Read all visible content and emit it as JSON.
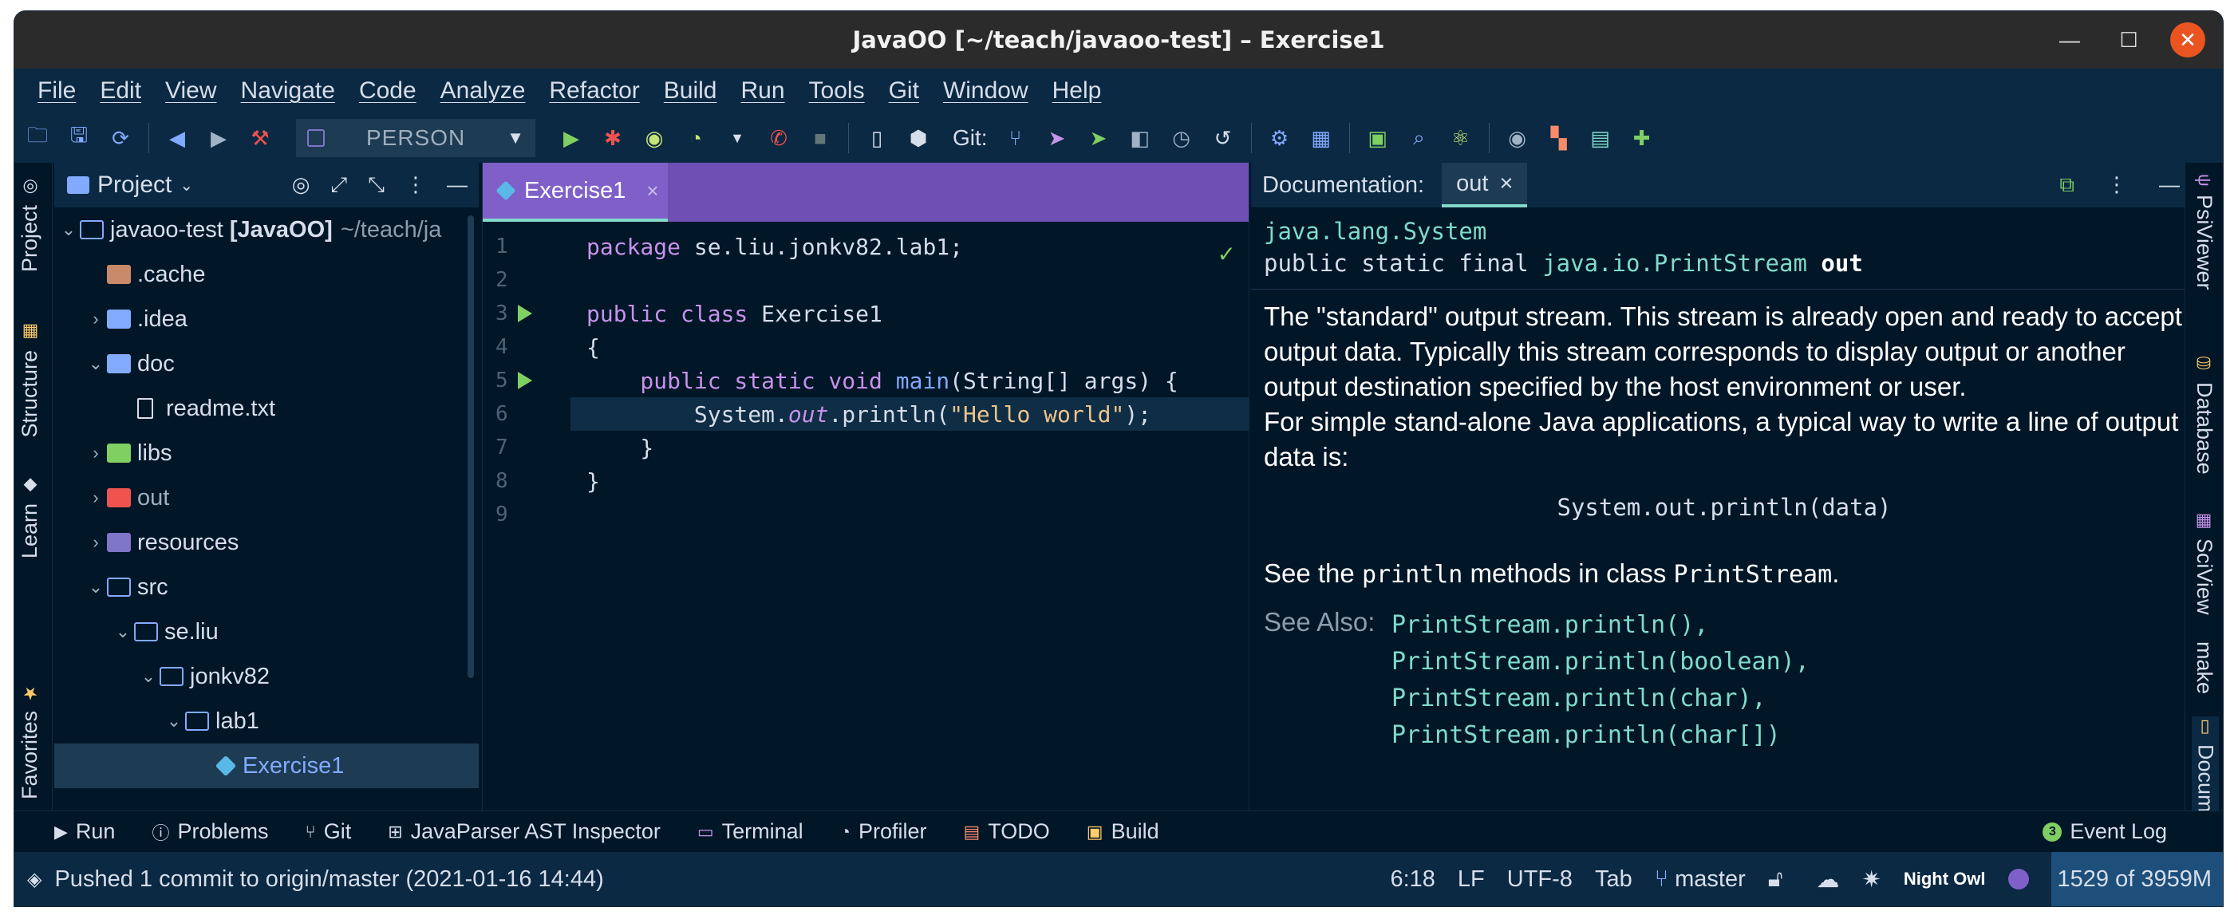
{
  "window": {
    "title": "JavaOO [~/teach/javaoo-test] – Exercise1"
  },
  "menu": [
    "File",
    "Edit",
    "View",
    "Navigate",
    "Code",
    "Analyze",
    "Refactor",
    "Build",
    "Run",
    "Tools",
    "Git",
    "Window",
    "Help"
  ],
  "toolbar": {
    "run_config": "PERSON",
    "git_label": "Git:"
  },
  "left_strip": {
    "project": "Project",
    "structure": "Structure",
    "learn": "Learn",
    "favorites": "Favorites"
  },
  "project_panel": {
    "title": "Project",
    "root": {
      "name": "javaoo-test",
      "module": "[JavaOO]",
      "path": "~/teach/ja"
    },
    "items": [
      ".cache",
      ".idea",
      "doc",
      "readme.txt",
      "libs",
      "out",
      "resources",
      "src",
      "se.liu",
      "jonkv82",
      "lab1",
      "Exercise1"
    ]
  },
  "editor": {
    "tab": "Exercise1",
    "line_numbers": [
      "1",
      "2",
      "3",
      "4",
      "5",
      "6",
      "7",
      "8",
      "9"
    ],
    "code": {
      "l1_kw": "package",
      "l1_rest": " se.liu.jonkv82.lab1;",
      "l3_kw": "public class",
      "l3_rest": " Exercise1",
      "l4": "{",
      "l5_kw": "    public static void",
      "l5_fn": " main",
      "l5_rest": "(String[] args) {",
      "l6_a": "        System.",
      "l6_field": "out",
      "l6_b": ".println(",
      "l6_str": "\"Hello world\"",
      "l6_c": ");",
      "l7": "    }",
      "l8": "}"
    }
  },
  "docs": {
    "label": "Documentation:",
    "tab": "out",
    "class_path": "java.lang.System",
    "sig_mods": "public static final ",
    "sig_type": "java.io.PrintStream",
    "sig_name": "out",
    "p1": "The \"standard\" output stream. This stream is already open and ready to accept output data. Typically this stream corresponds to display output or another output destination specified by the host environment or user.",
    "p2": "For simple stand-alone Java applications, a typical way to write a line of output data is:",
    "code_example": "System.out.println(data)",
    "p3_a": "See the ",
    "p3_m": "println",
    "p3_b": " methods in class ",
    "p3_c": "PrintStream",
    "p3_d": ".",
    "see_also_label": "See Also:",
    "see_also": [
      "PrintStream.println(),",
      "PrintStream.println(boolean),",
      "PrintStream.println(char),",
      "PrintStream.println(char[])"
    ]
  },
  "right_strip": {
    "psiviewer": "PsiViewer",
    "database": "Database",
    "sciview": "SciView",
    "make": "make",
    "docum": "Docum"
  },
  "bottom_tools": {
    "run": "Run",
    "problems": "Problems",
    "git": "Git",
    "ast": "JavaParser AST Inspector",
    "terminal": "Terminal",
    "profiler": "Profiler",
    "todo": "TODO",
    "build": "Build",
    "event_log": "Event Log",
    "event_count": "3"
  },
  "status": {
    "message": "Pushed 1 commit to origin/master (2021-01-16 14:44)",
    "position": "6:18",
    "line_sep": "LF",
    "encoding": "UTF-8",
    "indent": "Tab",
    "branch": "master",
    "theme": "Night Owl",
    "memory": "1529 of 3959M"
  },
  "colors": {
    "background": "#011627",
    "accent": "#7f60c9",
    "string": "#ecc48d",
    "keyword": "#c792ea",
    "link": "#7fdbca"
  }
}
